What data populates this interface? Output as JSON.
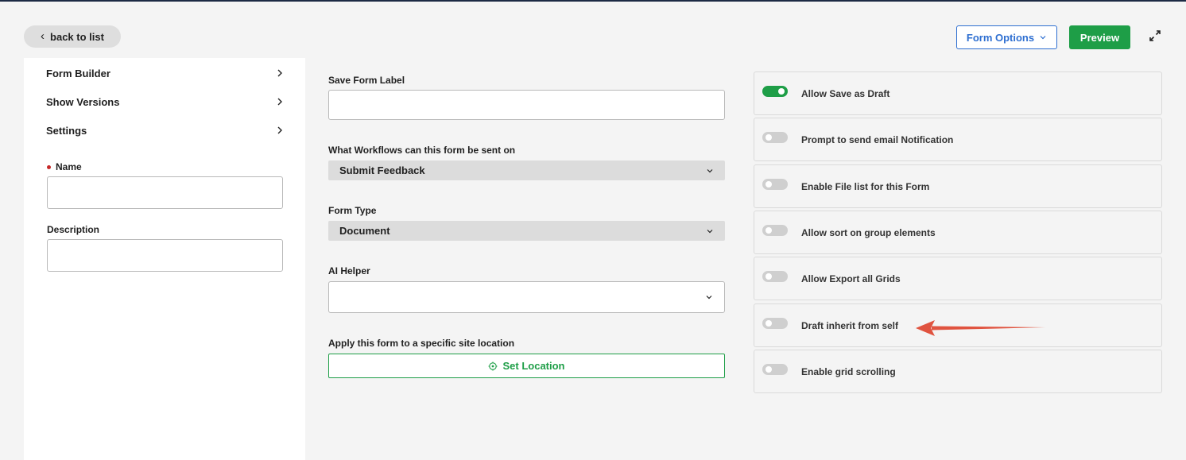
{
  "topbar": {
    "back_label": "back to list",
    "form_options_label": "Form Options",
    "preview_label": "Preview"
  },
  "left": {
    "nav": [
      {
        "label": "Form Builder"
      },
      {
        "label": "Show Versions"
      },
      {
        "label": "Settings"
      }
    ],
    "name_label": "Name",
    "name_value": "",
    "description_label": "Description",
    "description_value": ""
  },
  "middle": {
    "save_form_label": "Save Form Label",
    "save_form_value": "",
    "workflows_label": "What Workflows can this form be sent on",
    "workflows_value": "Submit Feedback",
    "form_type_label": "Form Type",
    "form_type_value": "Document",
    "ai_helper_label": "AI Helper",
    "ai_helper_value": "",
    "location_label": "Apply this form to a specific site location",
    "set_location_label": "Set Location"
  },
  "toggles": [
    {
      "label": "Allow Save as Draft",
      "on": true
    },
    {
      "label": "Prompt to send email Notification",
      "on": false
    },
    {
      "label": "Enable File list for this Form",
      "on": false
    },
    {
      "label": "Allow sort on group elements",
      "on": false
    },
    {
      "label": "Allow Export all Grids",
      "on": false
    },
    {
      "label": "Draft inherit from self",
      "on": false
    },
    {
      "label": "Enable grid scrolling",
      "on": false
    }
  ],
  "colors": {
    "accent_green": "#1e9e47",
    "accent_blue": "#2e6fd1",
    "required_red": "#c62828",
    "annotation_arrow": "#e0533f"
  }
}
